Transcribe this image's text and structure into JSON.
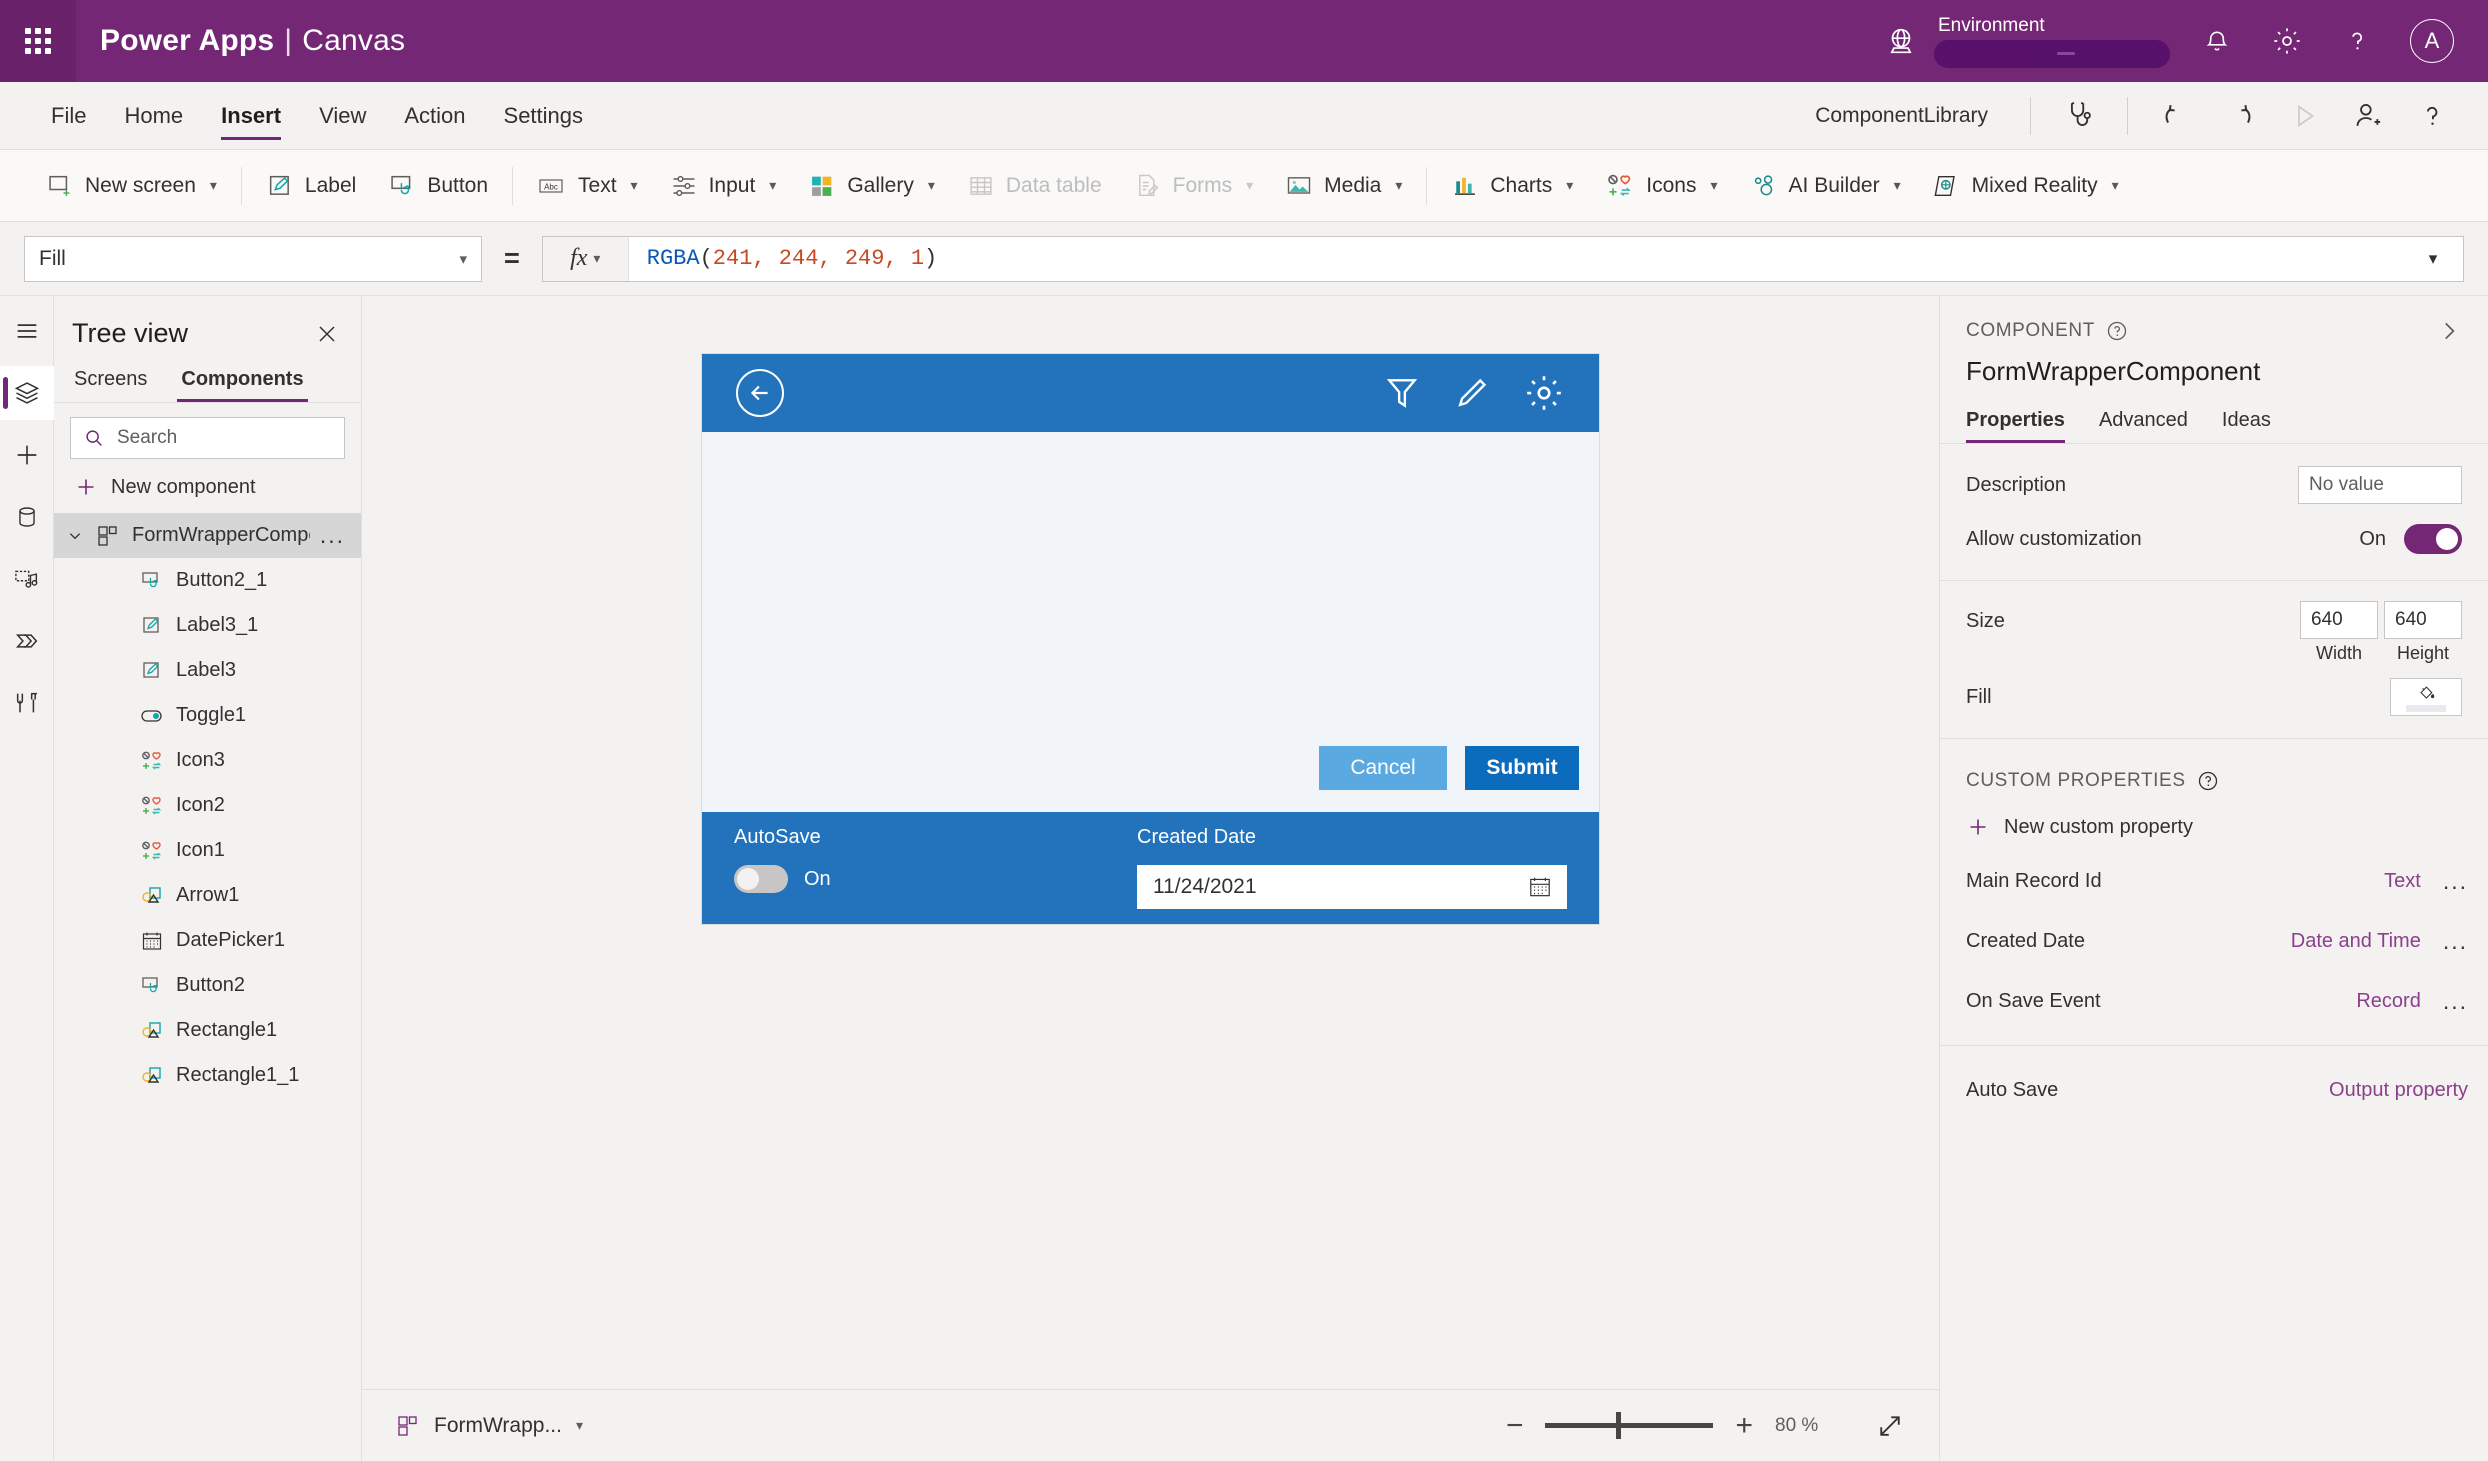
{
  "topbar": {
    "waffle_title": "App launcher",
    "brand": "Power Apps",
    "brand_separator": "|",
    "brand_sub": "Canvas",
    "environment_label": "Environment",
    "environment_value_redacted": "",
    "icons": [
      "globe-icon",
      "notification-bell-icon",
      "gear-icon",
      "help-icon"
    ],
    "avatar_initial": "A"
  },
  "menubar": {
    "items": [
      {
        "label": "File",
        "active": false
      },
      {
        "label": "Home",
        "active": false
      },
      {
        "label": "Insert",
        "active": true
      },
      {
        "label": "View",
        "active": false
      },
      {
        "label": "Action",
        "active": false
      },
      {
        "label": "Settings",
        "active": false
      }
    ],
    "app_name": "ComponentLibrary",
    "right_icons": [
      {
        "name": "app-checker-icon",
        "disabled": false
      },
      {
        "name": "undo-icon",
        "disabled": false
      },
      {
        "name": "redo-icon",
        "disabled": false
      },
      {
        "name": "play-preview-icon",
        "disabled": true
      },
      {
        "name": "share-user-icon",
        "disabled": false
      },
      {
        "name": "help-icon",
        "disabled": false
      }
    ]
  },
  "ribbon": {
    "items": [
      {
        "label": "New screen",
        "icon": "new-screen-icon",
        "caret": true,
        "disabled": false
      },
      {
        "label": "Label",
        "icon": "label-icon",
        "caret": false,
        "disabled": false
      },
      {
        "label": "Button",
        "icon": "button-icon",
        "caret": false,
        "disabled": false
      },
      {
        "label": "Text",
        "icon": "text-abc-icon",
        "caret": true,
        "disabled": false
      },
      {
        "label": "Input",
        "icon": "input-sliders-icon",
        "caret": true,
        "disabled": false
      },
      {
        "label": "Gallery",
        "icon": "gallery-icon",
        "caret": true,
        "disabled": false
      },
      {
        "label": "Data table",
        "icon": "data-table-icon",
        "caret": false,
        "disabled": true
      },
      {
        "label": "Forms",
        "icon": "forms-icon",
        "caret": true,
        "disabled": true
      },
      {
        "label": "Media",
        "icon": "media-image-icon",
        "caret": true,
        "disabled": false
      },
      {
        "label": "Charts",
        "icon": "charts-icon",
        "caret": true,
        "disabled": false
      },
      {
        "label": "Icons",
        "icon": "icons-icon",
        "caret": true,
        "disabled": false
      },
      {
        "label": "AI Builder",
        "icon": "ai-builder-icon",
        "caret": true,
        "disabled": false
      },
      {
        "label": "Mixed Reality",
        "icon": "mixed-reality-icon",
        "caret": true,
        "disabled": false
      }
    ]
  },
  "formula_bar": {
    "property_selected": "Fill",
    "equals": "=",
    "fx_label": "fx",
    "formula_fn": "RGBA",
    "formula_open": "(",
    "formula_args": "241, 244, 249, 1",
    "formula_close": ")",
    "formula_full": "RGBA(241, 244, 249, 1)",
    "colors": {
      "function": "#0b57b8",
      "number": "#c34a23",
      "punct": "#323130"
    }
  },
  "rail": {
    "items": [
      {
        "name": "hamburger-menu-icon",
        "active": false
      },
      {
        "name": "tree-view-layers-icon",
        "active": true
      },
      {
        "name": "insert-plus-icon",
        "active": false
      },
      {
        "name": "data-sources-icon",
        "active": false
      },
      {
        "name": "media-icon",
        "active": false
      },
      {
        "name": "power-automate-icon",
        "active": false
      },
      {
        "name": "advanced-tools-icon",
        "active": false
      }
    ]
  },
  "tree_view": {
    "title": "Tree view",
    "close_label": "Close",
    "tabs": [
      {
        "label": "Screens",
        "active": false
      },
      {
        "label": "Components",
        "active": true
      }
    ],
    "search_placeholder": "Search",
    "search_value": "",
    "new_component_label": "New component",
    "root": {
      "label": "FormWrapperComponent",
      "icon": "component-icon",
      "expanded": true,
      "selected": true,
      "overflow": "..."
    },
    "children": [
      {
        "label": "Button2_1",
        "icon": "button-icon"
      },
      {
        "label": "Label3_1",
        "icon": "label-icon"
      },
      {
        "label": "Label3",
        "icon": "label-icon"
      },
      {
        "label": "Toggle1",
        "icon": "toggle-icon"
      },
      {
        "label": "Icon3",
        "icon": "icons-icon"
      },
      {
        "label": "Icon2",
        "icon": "icons-icon"
      },
      {
        "label": "Icon1",
        "icon": "icons-icon"
      },
      {
        "label": "Arrow1",
        "icon": "shapes-icon"
      },
      {
        "label": "DatePicker1",
        "icon": "datepicker-calendar-icon"
      },
      {
        "label": "Button2",
        "icon": "button-icon"
      },
      {
        "label": "Rectangle1",
        "icon": "shapes-icon"
      },
      {
        "label": "Rectangle1_1",
        "icon": "shapes-icon"
      }
    ]
  },
  "canvas": {
    "header_icons": [
      "back-arrow-icon",
      "filter-funnel-icon",
      "edit-pencil-icon",
      "gear-icon"
    ],
    "buttons": {
      "cancel": "Cancel",
      "submit": "Submit"
    },
    "footer": {
      "autosave_label": "AutoSave",
      "autosave_state": "On",
      "created_date_label": "Created Date",
      "created_date_value": "11/24/2021",
      "calendar_icon": "calendar-icon"
    },
    "colors": {
      "header_blue": "#2273bb",
      "body": "#f1f4f9",
      "cancel": "#5aa9e0",
      "submit": "#0b6bbd"
    }
  },
  "statusbar": {
    "component_name": "FormWrapp...",
    "component_icon": "component-icon",
    "zoom_minus": "−",
    "zoom_plus": "+",
    "zoom_value": "80",
    "zoom_unit": "%",
    "fit_icon": "fit-to-screen-icon"
  },
  "properties_panel": {
    "kicker": "COMPONENT",
    "help_icon": "help-circle-icon",
    "collapse_icon": "chevron-right-icon",
    "title": "FormWrapperComponent",
    "tabs": [
      {
        "label": "Properties",
        "active": true
      },
      {
        "label": "Advanced",
        "active": false
      },
      {
        "label": "Ideas",
        "active": false
      }
    ],
    "description_label": "Description",
    "description_placeholder": "No value",
    "description_value": "",
    "allow_customization_label": "Allow customization",
    "allow_customization_state": "On",
    "size_label": "Size",
    "size_width_value": "640",
    "size_height_value": "640",
    "size_width_caption": "Width",
    "size_height_caption": "Height",
    "fill_label": "Fill",
    "fill_icon": "paint-bucket-icon",
    "custom_properties_title": "CUSTOM PROPERTIES",
    "new_custom_property_label": "New custom property",
    "custom_properties": [
      {
        "name": "Main Record Id",
        "type": "Text",
        "overflow": "..."
      },
      {
        "name": "Created Date",
        "type": "Date and Time",
        "overflow": "..."
      },
      {
        "name": "On Save Event",
        "type": "Record",
        "overflow": "..."
      }
    ],
    "output_properties": [
      {
        "name": "Auto Save",
        "type": "Output property"
      }
    ],
    "accent_color": "#742774",
    "link_color": "#8c3f8c"
  }
}
